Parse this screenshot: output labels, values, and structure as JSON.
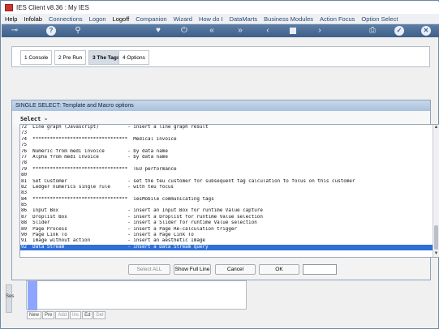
{
  "window": {
    "title": "IES Client v8.36 : My IES"
  },
  "menubar": {
    "items": [
      "Help",
      "Infolab",
      "Connections",
      "Logon",
      "Logoff",
      "Companion",
      "Wizard",
      "How do I",
      "DataMarts",
      "Business Modules",
      "Action Focus",
      "Option Select"
    ]
  },
  "tabs": [
    {
      "label": "1 Console"
    },
    {
      "label": "2 Pre Run"
    },
    {
      "label": "3 The Tags"
    },
    {
      "label": "4 Options"
    }
  ],
  "dialog": {
    "title": "SINGLE SELECT: Template and Macro options",
    "header": "Select -",
    "rows": [
      "72  Line graph (Javascript)          - insert a line graph result",
      "73",
      "74  *********************************  Medical invoice",
      "75",
      "76  Numeric from medi invoice        - by data name",
      "77  Alpha from medi invoice          - by data name",
      "78",
      "79  *********************************  TEU performance",
      "80",
      "81  Set Customer                     - set the teu customer for subsequent tag calculation to focus on this customer",
      "82  Ledger numerics single rule      - with teu focus",
      "83",
      "84  *********************************  iesMobile communicating tags",
      "85",
      "86  Input Box                        - insert an Input Box for runtime Value capture",
      "87  Droplist Box                     - insert a Droplist for runtime Value selection",
      "88  Slider                           - insert a Slider for runtime Value selection",
      "89  Page Process                     - insert a Page Re-calculation trigger",
      "90  Page Link To                     - insert a Page Link To",
      "91  Image without action             - insert an aesthetic Image",
      "92  Data Stream                      - insert a Data Stream query"
    ],
    "selected_row": "92  Data Stream                      - insert a Data Stream query",
    "buttons": {
      "select_all": "Select ALL",
      "show_full_line": "Show Full Line",
      "cancel": "Cancel",
      "ok": "OK"
    }
  },
  "lower": {
    "left_label": "Ses",
    "nav": [
      "New",
      "Pre",
      "Add",
      "Ins",
      "Ed",
      "Del"
    ]
  }
}
